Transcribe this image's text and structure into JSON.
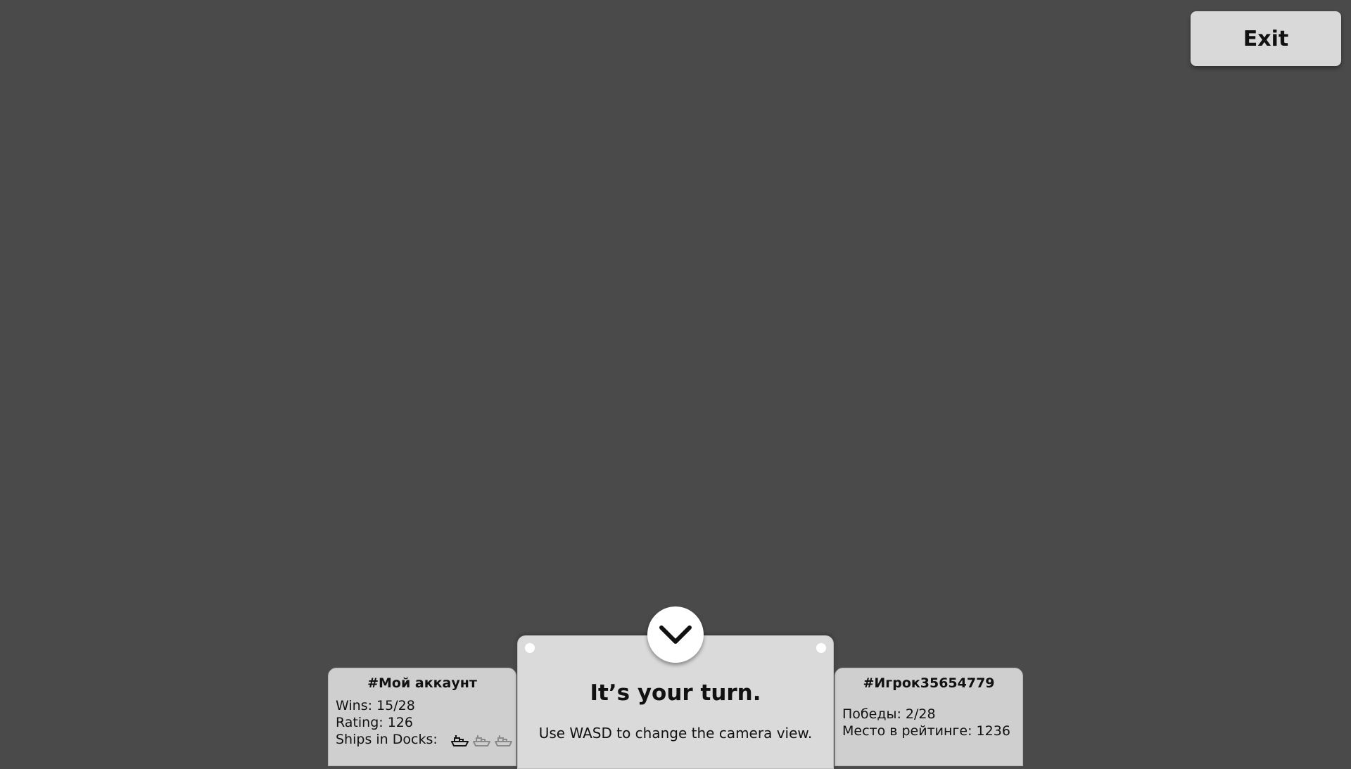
{
  "header": {
    "exit_label": "Exit"
  },
  "player_left": {
    "name": "#Мой аккаунт",
    "wins": "Wins: 15/28",
    "rating": "Rating: 126",
    "ships_label": "Ships in Docks:",
    "ships": [
      {
        "icon": "ship-icon",
        "state": "active"
      },
      {
        "icon": "ship-icon",
        "state": "inactive"
      },
      {
        "icon": "ship-icon",
        "state": "inactive"
      }
    ]
  },
  "player_right": {
    "name": "#Игрок35654779",
    "wins": "Победы: 2/28",
    "rating": "Место в рейтинге: 1236"
  },
  "turn_panel": {
    "title": "It’s your turn.",
    "hint": "Use WASD to change the camera view.",
    "collapse_icon": "chevron-down-icon"
  },
  "colors": {
    "background": "#4a4a4a",
    "panel": "#dadada",
    "card": "#cfcfcf",
    "button": "#d9d9d9",
    "ship_active": "#111111",
    "ship_inactive": "#8a8a8a"
  }
}
